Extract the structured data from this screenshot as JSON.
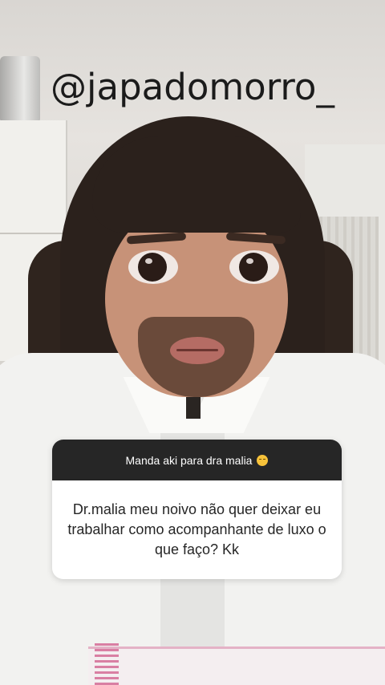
{
  "overlay": {
    "username": "@japadomorro_"
  },
  "question_sticker": {
    "prompt": "Manda aki para dra malia",
    "prompt_emoji": "pensive-face-icon",
    "answer": "Dr.malia meu noivo não quer deixar eu trabalhar como acompanhante de luxo o que faço? Kk",
    "colors": {
      "header_bg": "#262626",
      "header_text": "#ffffff",
      "body_bg": "#ffffff",
      "body_text": "#262626"
    }
  }
}
